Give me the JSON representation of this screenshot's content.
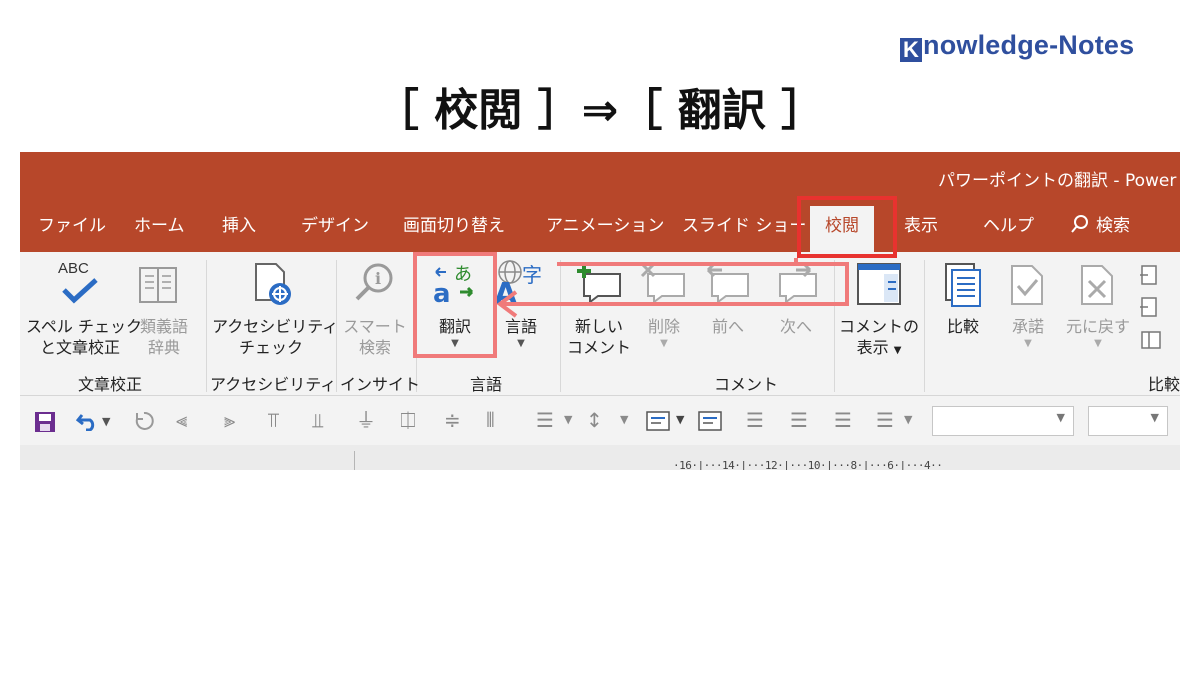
{
  "brand": {
    "k": "K",
    "rest": "nowledge-Notes"
  },
  "headline": "［ 校閲 ］⇒［ 翻訳 ］",
  "window": {
    "title": "パワーポイントの翻訳 - Power"
  },
  "tabs": [
    "ファイル",
    "ホーム",
    "挿入",
    "デザイン",
    "画面切り替え",
    "アニメーション",
    "スライド ショー",
    "校閲",
    "表示",
    "ヘルプ",
    "検索"
  ],
  "ribbon": {
    "spelling": {
      "line1": "スペル チェック",
      "line2": "と文章校正",
      "abc": "ABC"
    },
    "thesaurus": {
      "line1": "類義語",
      "line2": "辞典"
    },
    "accessibility": {
      "line1": "アクセシビリティ",
      "line2": "チェック"
    },
    "smart_lookup": {
      "line1": "スマート",
      "line2": "検索"
    },
    "translate": {
      "label": "翻訳"
    },
    "language": {
      "label": "言語"
    },
    "new_comment": {
      "line1": "新しい",
      "line2": "コメント"
    },
    "delete": {
      "label": "削除"
    },
    "previous": {
      "label": "前へ"
    },
    "next": {
      "label": "次へ"
    },
    "show_comments": {
      "line1": "コメントの",
      "line2": "表示"
    },
    "compare": {
      "label": "比較"
    },
    "accept": {
      "label": "承諾"
    },
    "reject": {
      "label": "元に戻す"
    },
    "groups": {
      "proofing": "文章校正",
      "accessibility": "アクセシビリティ",
      "insights": "インサイト",
      "language": "言語",
      "comments": "コメント",
      "compare": "比較"
    }
  },
  "ruler": "·16·|···14·|···12·|···10·|···8·|···6·|···4··",
  "colors": {
    "accent": "#b7472a",
    "highlight": "#e8322f",
    "brand": "#2f4f9e"
  }
}
